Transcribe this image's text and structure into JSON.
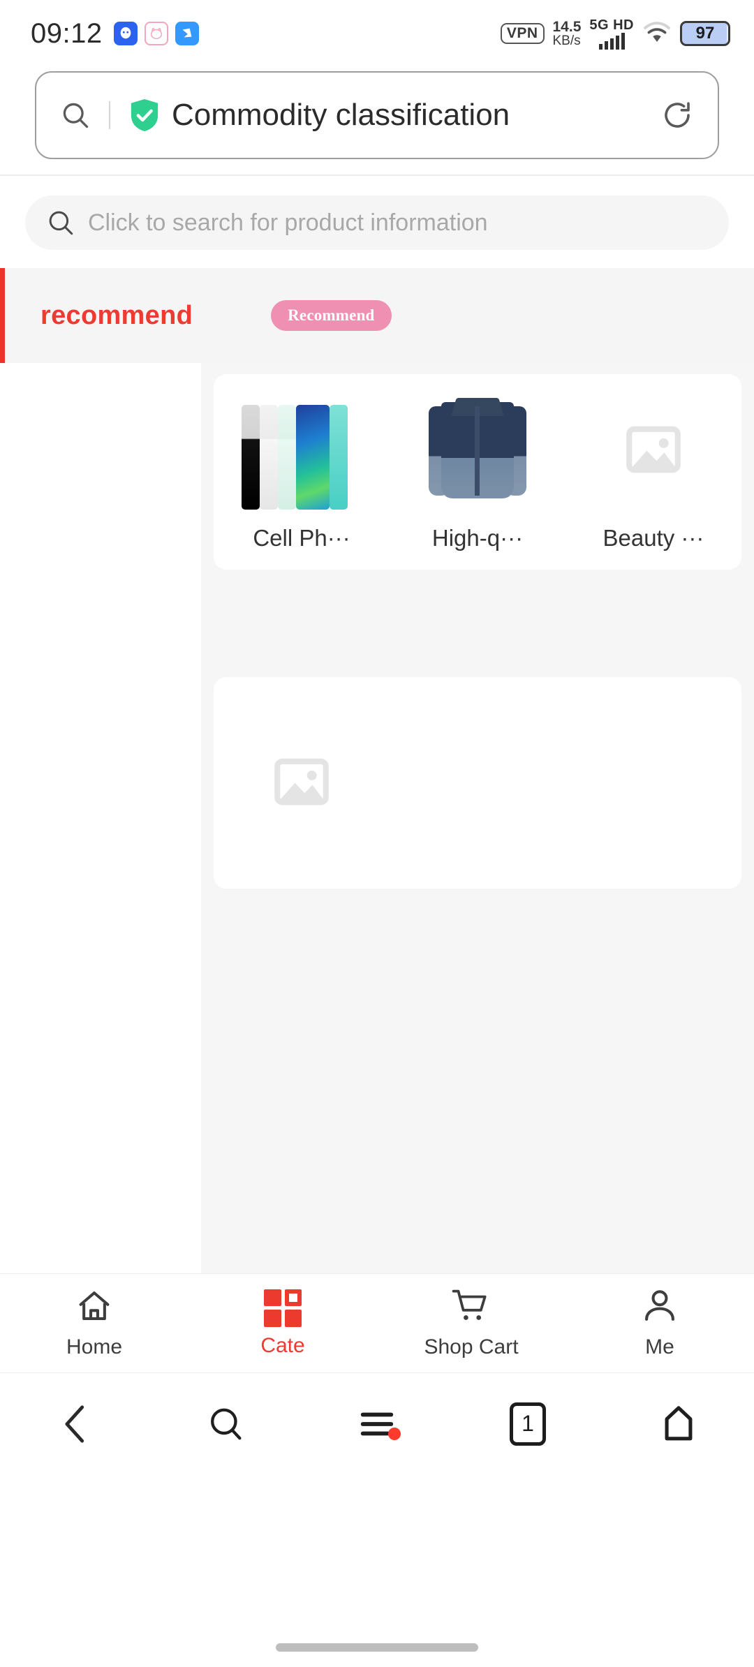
{
  "status_bar": {
    "time": "09:12",
    "app_icons": [
      "qq-icon",
      "pink-pig-icon",
      "blue-bird-icon"
    ],
    "vpn_label": "VPN",
    "net_speed_value": "14.5",
    "net_speed_unit": "KB/s",
    "network_type": "5G HD",
    "signal_bars": 5,
    "wifi": "wifi-icon",
    "battery_percent": "97"
  },
  "browser": {
    "url_bar": {
      "search_icon": "search-icon",
      "secure_icon": "shield-check-icon",
      "title": "Commodity classification",
      "reload_icon": "refresh-icon"
    },
    "nav": {
      "back": "back-chevron-icon",
      "search": "search-icon",
      "menu": "hamburger-menu-icon",
      "menu_has_notification": true,
      "tab_count": "1",
      "home": "home-pentagon-icon"
    }
  },
  "page": {
    "search": {
      "icon": "search-icon",
      "placeholder": "Click to search for product information",
      "value": ""
    },
    "category_header": {
      "title": "recommend",
      "badge": "Recommend",
      "accent_color": "#ee3b32",
      "badge_color": "#ef8fb2"
    },
    "sidebar": {
      "items": []
    },
    "cards": [
      {
        "type": "grid",
        "tiles": [
          {
            "label": "Cell Ph···",
            "image": "cell-phone-lineup-image"
          },
          {
            "label": "High-q···",
            "image": "mens-shirt-image"
          },
          {
            "label": "Beauty ···",
            "image": "image-placeholder-icon"
          }
        ]
      },
      {
        "type": "single",
        "tiles": [
          {
            "label": "",
            "image": "image-placeholder-icon"
          }
        ]
      }
    ]
  },
  "bottom_tabs": [
    {
      "label": "Home",
      "icon": "home-icon",
      "active": false
    },
    {
      "label": "Cate",
      "icon": "grid-icon",
      "active": true
    },
    {
      "label": "Shop Cart",
      "icon": "shopping-cart-icon",
      "active": false
    },
    {
      "label": "Me",
      "icon": "person-icon",
      "active": false
    }
  ]
}
